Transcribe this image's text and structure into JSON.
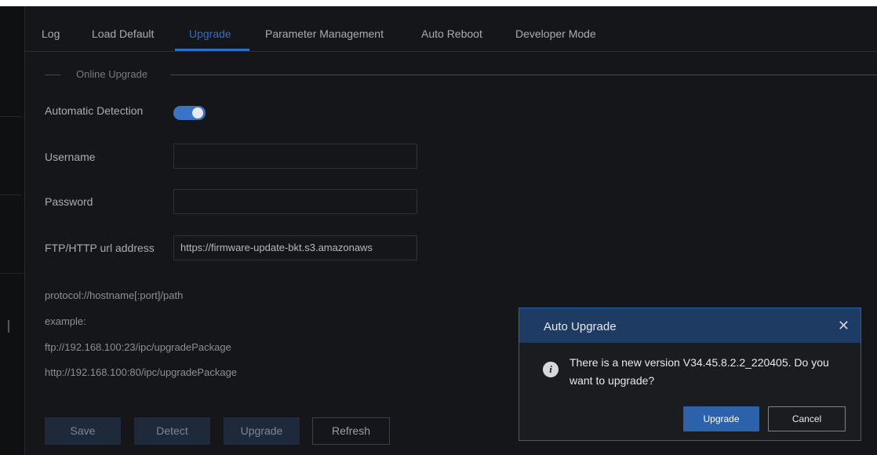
{
  "tabs": [
    {
      "label": "Log",
      "active": false
    },
    {
      "label": "Load Default",
      "active": false
    },
    {
      "label": "Upgrade",
      "active": true
    },
    {
      "label": "Parameter Management",
      "active": false
    },
    {
      "label": "Auto Reboot",
      "active": false
    },
    {
      "label": "Developer Mode",
      "active": false
    }
  ],
  "section": {
    "title": "Online Upgrade"
  },
  "form": {
    "auto_detection_label": "Automatic Detection",
    "auto_detection_on": true,
    "username_label": "Username",
    "username_value": "",
    "password_label": "Password",
    "password_value": "",
    "url_label": "FTP/HTTP url address",
    "url_value": "https://firmware-update-bkt.s3.amazonaws"
  },
  "help": {
    "format": "protocol://hostname[:port]/path",
    "example_label": "example:",
    "example_ftp": "ftp://192.168.100:23/ipc/upgradePackage",
    "example_http": "http://192.168.100:80/ipc/upgradePackage"
  },
  "buttons": {
    "save": "Save",
    "detect": "Detect",
    "upgrade": "Upgrade",
    "refresh": "Refresh"
  },
  "dialog": {
    "title": "Auto Upgrade",
    "close_glyph": "✕",
    "info_glyph": "i",
    "message": "There is a new version V34.45.8.2.2_220405. Do you want to upgrade?",
    "confirm_label": "Upgrade",
    "cancel_label": "Cancel"
  },
  "colors": {
    "accent": "#2f6ec7",
    "background": "#151619",
    "dialog_header": "#1e3b63"
  }
}
